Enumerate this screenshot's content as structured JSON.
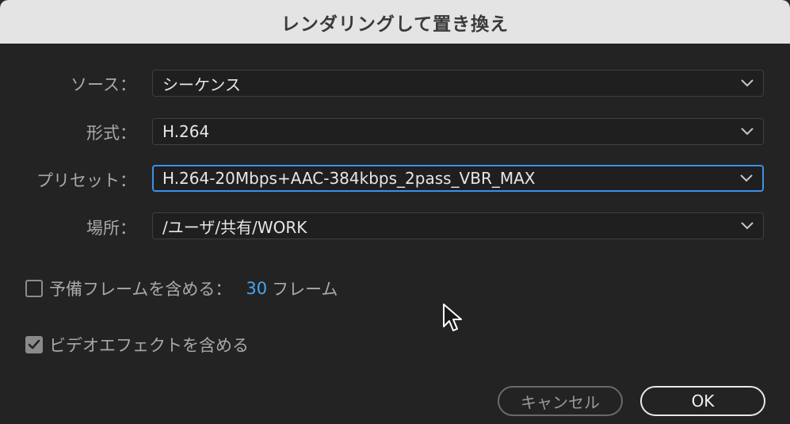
{
  "dialog": {
    "title": "レンダリングして置き換え"
  },
  "source": {
    "label": "ソース：",
    "value": "シーケンス"
  },
  "format": {
    "label": "形式：",
    "value": "H.264"
  },
  "preset": {
    "label": "プリセット：",
    "value": "H.264-20Mbps+AAC-384kbps_2pass_VBR_MAX"
  },
  "location": {
    "label": "場所：",
    "value": "/ユーザ/共有/WORK"
  },
  "handles": {
    "label": "予備フレームを含める：",
    "value": "30",
    "unit": "フレーム",
    "checked": false
  },
  "video_effects": {
    "label": "ビデオエフェクトを含める",
    "checked": true
  },
  "buttons": {
    "cancel": "キャンセル",
    "ok": "OK"
  },
  "colors": {
    "accent": "#3d8fe8",
    "value_blue": "#4aa3f0"
  },
  "icons": {
    "dropdown": "chevron-down-icon",
    "checkmark": "checkmark-icon",
    "cursor": "mouse-pointer-icon"
  }
}
